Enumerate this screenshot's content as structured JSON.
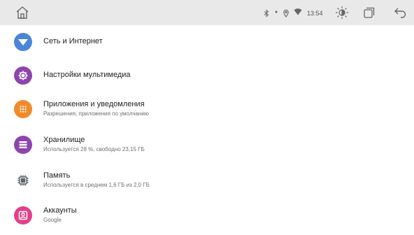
{
  "status_bar": {
    "time": "13:54",
    "icons": [
      "home-icon",
      "bluetooth-icon",
      "dot-icon",
      "location-icon",
      "wifi-icon",
      "brightness-icon",
      "recents-icon",
      "back-icon"
    ]
  },
  "colors": {
    "network": "#4a86d8",
    "multimedia": "#8e44ad",
    "apps": "#f28a2b",
    "storage": "#8e44ad",
    "memory": "#5f6368",
    "accounts": "#e0408a"
  },
  "settings": {
    "items": [
      {
        "title": "Сеть и Интернет",
        "icon": "network-icon"
      },
      {
        "title": "Настройки мультимедиа",
        "icon": "multimedia-settings-icon"
      },
      {
        "title": "Приложения и уведомления",
        "subtitle": "Разрешения, приложения по умолчанию",
        "icon": "apps-icon"
      },
      {
        "title": "Хранилище",
        "subtitle": "Используется 28 %, свободно 23,15 ГБ",
        "icon": "storage-icon"
      },
      {
        "title": "Память",
        "subtitle": "Используется в среднем 1,6 ГБ из 2,0 ГБ",
        "icon": "memory-icon"
      },
      {
        "title": "Аккаунты",
        "subtitle": "Google",
        "icon": "accounts-icon"
      }
    ]
  }
}
